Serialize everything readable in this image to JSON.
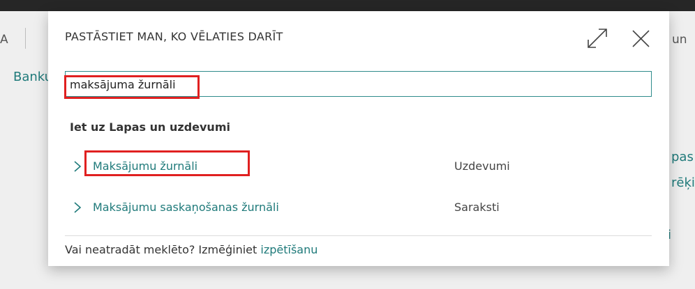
{
  "background": {
    "left_char": "A",
    "banku_link": "Banku",
    "right_un": "un",
    "right_pas": "pas",
    "right_reki": "rēķi",
    "right_i": "i"
  },
  "dialog": {
    "title": "PASTĀSTIET MAN, KO VĒLATIES DARĪT",
    "expand_icon": "expand-icon",
    "close_icon": "close-icon",
    "search_value": "maksājuma žurnāli",
    "section_heading": "Iet uz Lapas un uzdevumi",
    "results": [
      {
        "label": "Maksājumu žurnāli",
        "type": "Uzdevumi"
      },
      {
        "label": "Maksājumu saskaņošanas žurnāli",
        "type": "Saraksti"
      }
    ],
    "footer_text": "Vai neatradāt meklēto? Izmēģiniet ",
    "footer_link": "izpētīšanu"
  },
  "colors": {
    "accent": "#1f7a7a",
    "highlight": "#e02020",
    "topbar": "#262626"
  }
}
